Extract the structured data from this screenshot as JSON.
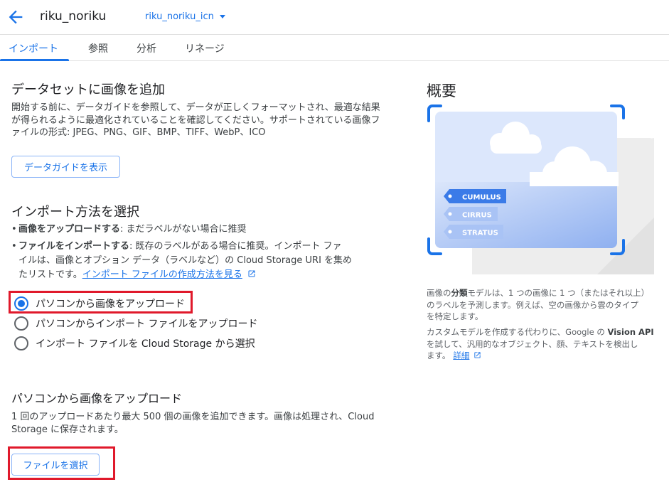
{
  "header": {
    "dataset_name": "riku_noriku",
    "dataset_selector": "riku_noriku_icn"
  },
  "tabs": [
    {
      "label": "インポート",
      "active": true
    },
    {
      "label": "参照",
      "active": false
    },
    {
      "label": "分析",
      "active": false
    },
    {
      "label": "リネージ",
      "active": false
    }
  ],
  "add_images": {
    "title": "データセットに画像を追加",
    "desc_line1": "開始する前に、データガイドを参照して、データが正しくフォーマットされ、最適な結果",
    "desc_line2": "が得られるように最適化されていることを確認してください。サポートされている画像フ",
    "desc_line3": "ァイルの形式: JPEG、PNG、GIF、BMP、TIFF、WebP、ICO",
    "guide_button": "データガイドを表示"
  },
  "import_method": {
    "title": "インポート方法を選択",
    "bullet1_bold": "画像をアップロードする",
    "bullet1_rest": ": まだラベルがない場合に推奨",
    "bullet2_bold": "ファイルをインポートする",
    "bullet2_rest": ": 既存のラベルがある場合に推奨。インポート ファ",
    "bullet2_line2": "イルは、画像とオプション データ（ラベルなど）の Cloud Storage URI を集め",
    "bullet2_line3_pre": "たリストです。",
    "bullet2_link": "インポート ファイルの作成方法を見る",
    "options": [
      {
        "label": "パソコンから画像をアップロード",
        "selected": true
      },
      {
        "label": "パソコンからインポート ファイルをアップロード",
        "selected": false
      },
      {
        "label": "インポート ファイルを Cloud Storage から選択",
        "selected": false
      }
    ]
  },
  "upload": {
    "title": "パソコンから画像をアップロード",
    "desc_line1": "1 回のアップロードあたり最大 500 個の画像を追加できます。画像は処理され、Cloud",
    "desc_line2": "Storage に保存されます。",
    "select_button": "ファイルを選択"
  },
  "overview": {
    "title": "概要",
    "labels": [
      "CUMULUS",
      "CIRRUS",
      "STRATUS"
    ],
    "p1_line1_pre": "画像の",
    "p1_line1_bold": "分類",
    "p1_line1_post": "モデルは、1 つの画像に 1 つ（またはそれ以上）",
    "p1_line2": "のラベルを予測します。例えば、空の画像から雲のタイプ",
    "p1_line3": "を特定します。",
    "p2_line1_pre": "カスタムモデルを作成する代わりに、Google の ",
    "p2_line1_bold": "Vision API",
    "p2_line2": "を試して、汎用的なオブジェクト、顔、テキストを検出し",
    "p2_line3_pre": "ます。",
    "p2_link": "詳細"
  },
  "colors": {
    "accent": "#1a73e8",
    "highlight": "#e0192b"
  }
}
